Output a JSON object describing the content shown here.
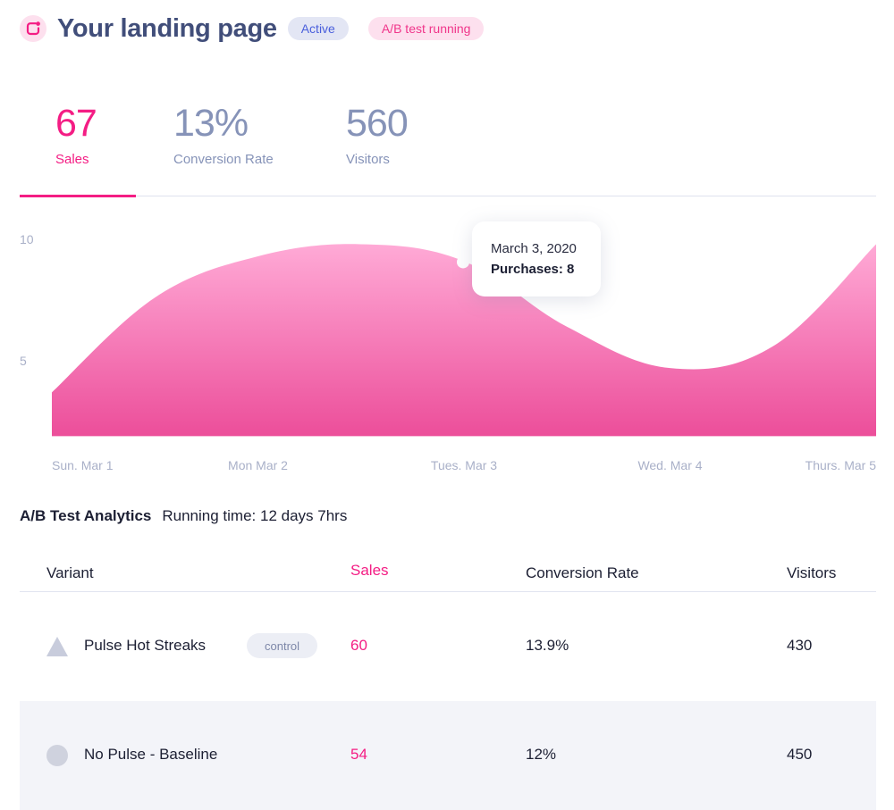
{
  "header": {
    "logo_icon": "pulse-logo-icon",
    "title": "Your landing page",
    "badges": [
      {
        "label": "Active",
        "color": "#4a5fdc",
        "bg": "#e3e6f4"
      },
      {
        "label": "A/B test running",
        "color": "#f0358a",
        "bg": "#fde0ee"
      }
    ]
  },
  "stats": [
    {
      "value": "67",
      "label": "Sales",
      "active": true
    },
    {
      "value": "13%",
      "label": "Conversion Rate",
      "active": false
    },
    {
      "value": "560",
      "label": "Visitors",
      "active": false
    }
  ],
  "colors": {
    "accent": "#f41d84",
    "muted": "#8693b8",
    "area_top": "#ffaad6",
    "area_bottom": "#ec4e9a"
  },
  "chart_data": {
    "type": "area",
    "title": "",
    "xlabel": "",
    "ylabel": "",
    "ylim": [
      0,
      10
    ],
    "y_ticks": [
      "10",
      "5"
    ],
    "y_tick_values": [
      10,
      5
    ],
    "categories": [
      "Sun. Mar 1",
      "Mon Mar 2",
      "Tues. Mar 3",
      "Wed. Mar 4",
      "Thurs. Mar 5"
    ],
    "x": [
      0,
      0.5,
      1,
      1.5,
      2,
      2.5,
      3,
      3.5,
      4
    ],
    "series": [
      {
        "name": "Purchases",
        "values": [
          3.7,
          7.6,
          9.3,
          9.8,
          9.1,
          6.4,
          4.7,
          5.6,
          9.8
        ]
      }
    ],
    "baseline": 1.9,
    "grid": false,
    "legend": "none",
    "tooltip": {
      "date": "March 3, 2020",
      "label": "Purchases: 8",
      "x": 2,
      "y": 9.1
    }
  },
  "ab_test": {
    "title": "A/B Test Analytics",
    "running_time": "Running time: 12 days 7hrs",
    "columns": [
      "Variant",
      "Sales",
      "Conversion Rate",
      "Visitors"
    ],
    "rows": [
      {
        "icon": "triangle-icon",
        "variant": "Pulse Hot Streaks",
        "tag": "control",
        "sales": "60",
        "conversion_rate": "13.9%",
        "visitors": "430"
      },
      {
        "icon": "circle-icon",
        "variant": "No Pulse - Baseline",
        "tag": "",
        "sales": "54",
        "conversion_rate": "12%",
        "visitors": "450"
      }
    ]
  }
}
